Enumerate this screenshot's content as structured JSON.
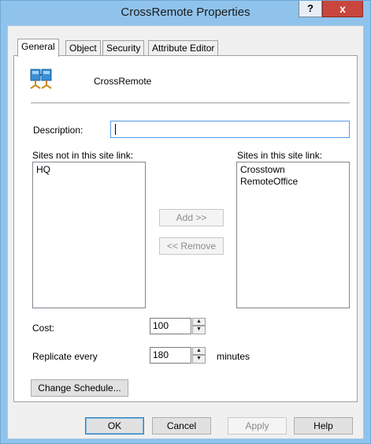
{
  "window": {
    "title": "CrossRemote Properties",
    "help_glyph": "?",
    "close_glyph": "x"
  },
  "tabs": [
    {
      "label": "General",
      "active": true
    },
    {
      "label": "Object",
      "active": false
    },
    {
      "label": "Security",
      "active": false
    },
    {
      "label": "Attribute Editor",
      "active": false
    }
  ],
  "object": {
    "name": "CrossRemote",
    "icon": "site-link-icon"
  },
  "description": {
    "label": "Description:",
    "value": ""
  },
  "sites_not_in_link": {
    "label": "Sites not in this site link:",
    "items": [
      "HQ"
    ]
  },
  "sites_in_link": {
    "label": "Sites in this site link:",
    "items": [
      "Crosstown",
      "RemoteOffice"
    ]
  },
  "move_buttons": {
    "add_label": "Add >>",
    "remove_label": "<< Remove"
  },
  "cost": {
    "label": "Cost:",
    "value": "100"
  },
  "replicate": {
    "label": "Replicate every",
    "value": "180",
    "unit": "minutes"
  },
  "change_schedule_label": "Change Schedule...",
  "dialog_buttons": {
    "ok": "OK",
    "cancel": "Cancel",
    "apply": "Apply",
    "help": "Help"
  }
}
